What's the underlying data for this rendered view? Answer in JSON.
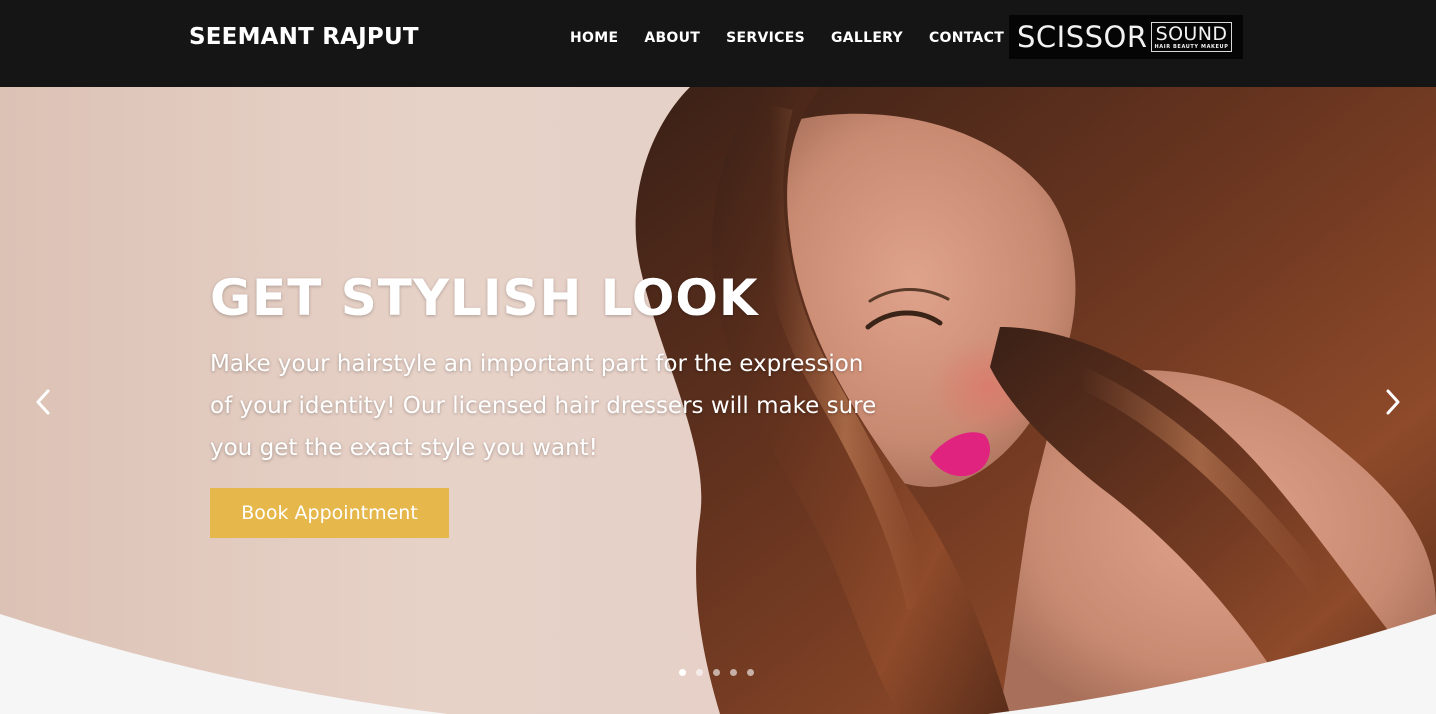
{
  "brand": {
    "name": "SEEMANT RAJPUT"
  },
  "nav": {
    "items": [
      {
        "label": "HOME"
      },
      {
        "label": "ABOUT"
      },
      {
        "label": "SERVICES"
      },
      {
        "label": "GALLERY"
      },
      {
        "label": "CONTACT"
      }
    ]
  },
  "logo": {
    "main": "SCISSOR",
    "box_word": "SOUND",
    "tagline": "HAIR  BEAUTY  MAKEUP"
  },
  "hero": {
    "title": "GET STYLISH LOOK",
    "description": "Make your hairstyle an important part for the expression of your identity! Our licensed hair dressers will make sure you get the exact style you want!",
    "cta_label": "Book Appointment",
    "slides": {
      "count": 5,
      "active": 1
    }
  },
  "colors": {
    "header_bg": "#151515",
    "accent": "#e6b74b",
    "page_bg": "#f6f6f6",
    "lipstick": "#e0237f"
  },
  "icons": {
    "prev": "chevron-left-icon",
    "next": "chevron-right-icon"
  }
}
